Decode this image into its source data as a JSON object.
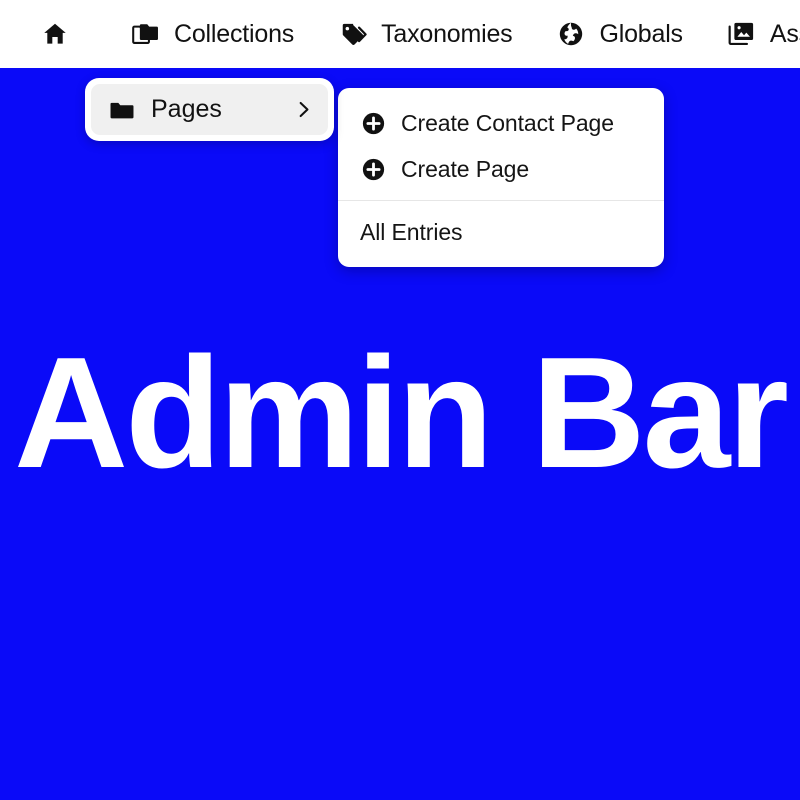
{
  "theme": {
    "page_background": "#0A0AF8",
    "bar_background": "#ffffff",
    "text_color": "#121212",
    "trigger_background": "#f0f0f0",
    "divider_color": "#e6e6e6",
    "hero_text_color": "#ffffff"
  },
  "admin_bar": {
    "items": [
      {
        "icon": "home-icon",
        "label": ""
      },
      {
        "icon": "folders-icon",
        "label": "Collections"
      },
      {
        "icon": "tag-icon",
        "label": "Taxonomies"
      },
      {
        "icon": "globe-icon",
        "label": "Globals"
      },
      {
        "icon": "images-icon",
        "label": "Asse"
      }
    ]
  },
  "pages_trigger": {
    "icon": "folder-icon",
    "label": "Pages",
    "chevron": "chevron-right-icon"
  },
  "dropdown": {
    "create_items": [
      {
        "icon": "plus-circle-icon",
        "label": "Create Contact Page"
      },
      {
        "icon": "plus-circle-icon",
        "label": "Create Page"
      }
    ],
    "all_entries_label": "All Entries"
  },
  "hero": {
    "title": "Admin Bar"
  }
}
